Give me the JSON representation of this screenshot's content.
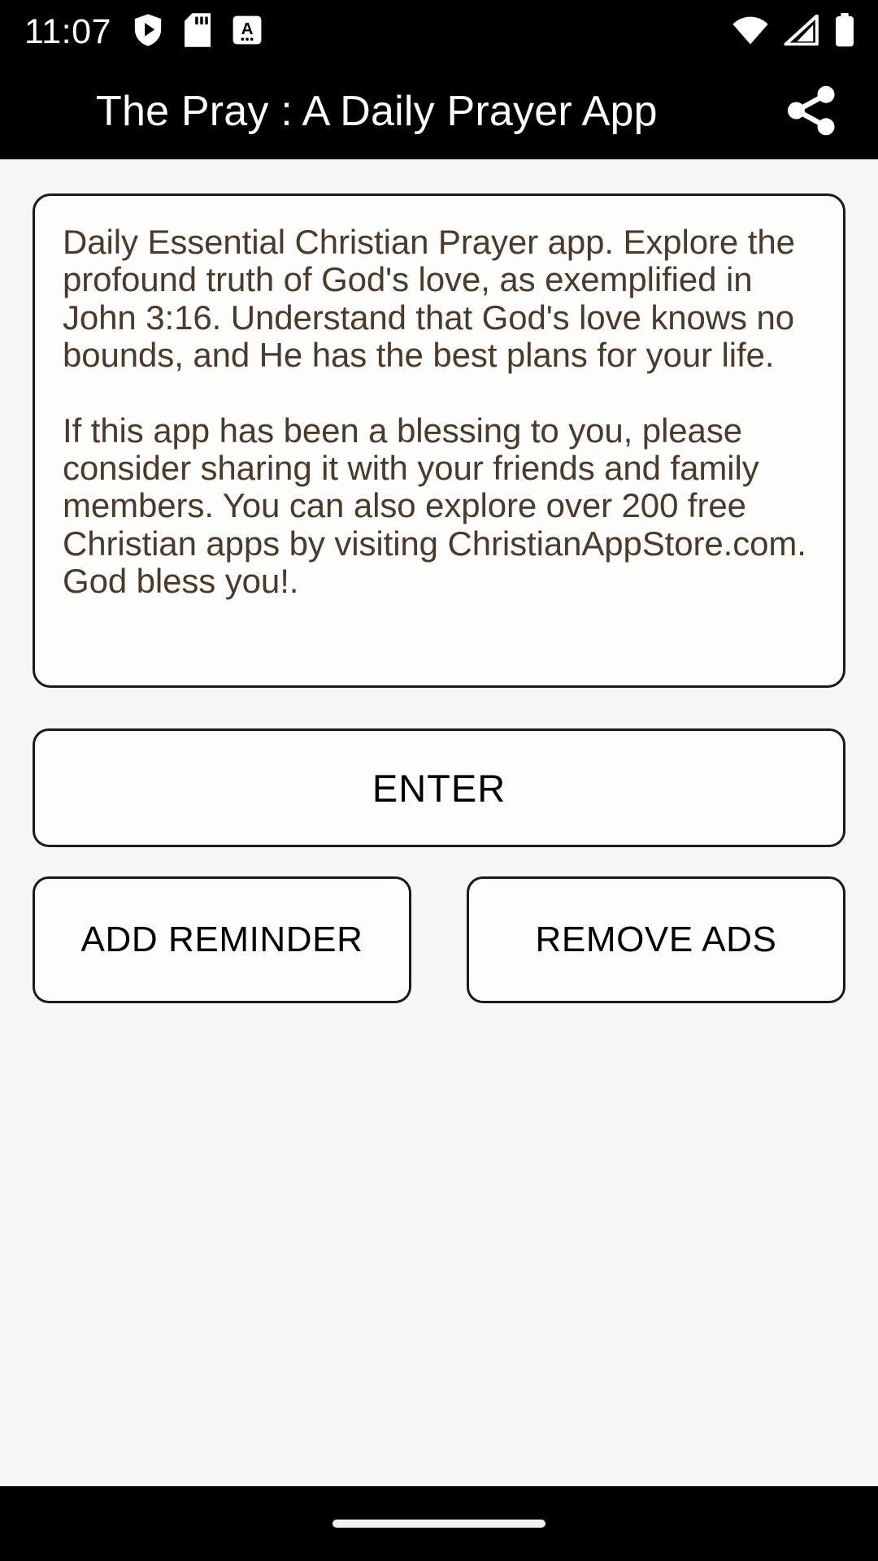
{
  "status_bar": {
    "time": "11:07",
    "left_icons": [
      "play-protect-icon",
      "sd-card-icon",
      "keyboard-language-icon"
    ],
    "right_icons": [
      "wifi-icon",
      "cellular-signal-icon",
      "battery-full-icon"
    ],
    "background_color": "#000000",
    "foreground_color": "#ffffff"
  },
  "app_bar": {
    "title": "The Pray : A Daily Prayer App",
    "share_icon": "share-icon",
    "background_color": "#000000",
    "title_color": "#ffffff"
  },
  "main": {
    "description_card": {
      "paragraph_1": "Daily Essential Christian Prayer app. Explore the profound truth of God's love, as exemplified in John 3:16. Understand that God's love knows no bounds, and He has the best plans for your life.",
      "paragraph_2": "If this app has been a blessing to you, please consider sharing it with your friends and family members. You can also explore over 200 free Christian apps by visiting ChristianAppStore.com. God bless you!.",
      "text_color": "#4a3a2b",
      "border_color": "#1a1a1a",
      "background_color": "#fdfdfb"
    },
    "buttons": {
      "enter": "ENTER",
      "add_reminder": "ADD REMINDER",
      "remove_ads": "REMOVE ADS",
      "text_color": "#000000",
      "border_color": "#1a1a1a",
      "background_color": "#fdfdfd"
    },
    "background_color": "#f7f7f7"
  },
  "nav_bar": {
    "gesture_pill": "home-gesture-pill",
    "background_color": "#000000",
    "pill_color": "#f2f2f2"
  }
}
